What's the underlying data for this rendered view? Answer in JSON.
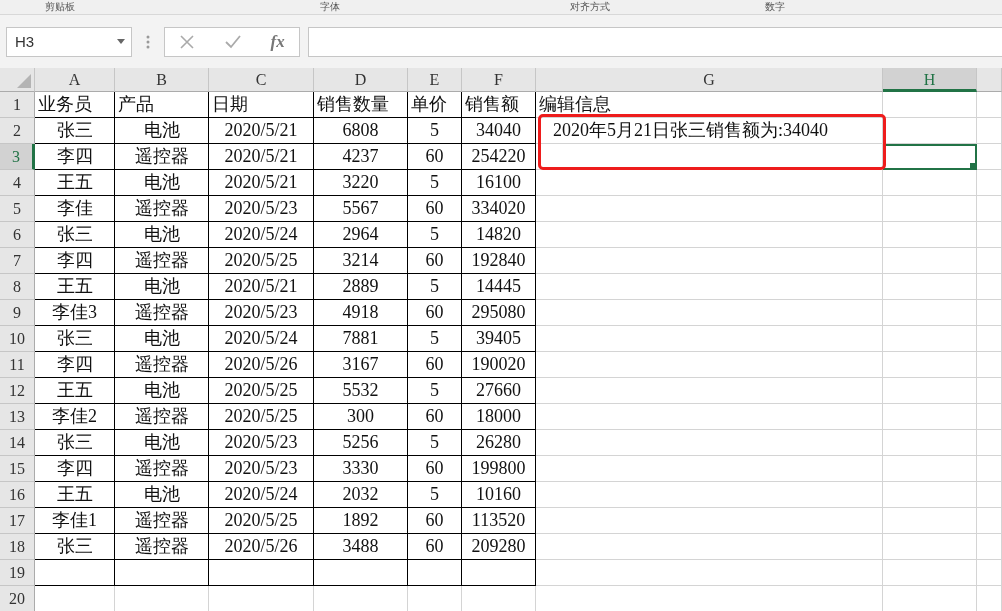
{
  "ribbon_groups": [
    "剪贴板",
    "字体",
    "对齐方式",
    "数字"
  ],
  "name_box": {
    "value": "H3"
  },
  "formula_bar": {
    "function_label": "fx"
  },
  "columns": [
    {
      "label": "A",
      "selected": false
    },
    {
      "label": "B",
      "selected": false
    },
    {
      "label": "C",
      "selected": false
    },
    {
      "label": "D",
      "selected": false
    },
    {
      "label": "E",
      "selected": false
    },
    {
      "label": "F",
      "selected": false
    },
    {
      "label": "G",
      "selected": false
    },
    {
      "label": "H",
      "selected": true
    }
  ],
  "rows": [
    {
      "number": "1",
      "selected": false,
      "cells": [
        "业务员",
        "产品",
        "日期",
        "销售数量",
        "单价",
        "销售额"
      ],
      "g": "编辑信息"
    },
    {
      "number": "2",
      "selected": false,
      "cells": [
        "张三",
        "电池",
        "2020/5/21",
        "6808",
        "5",
        "34040"
      ],
      "g": "2020年5月21日张三销售额为:34040"
    },
    {
      "number": "3",
      "selected": true,
      "cells": [
        "李四",
        "遥控器",
        "2020/5/21",
        "4237",
        "60",
        "254220"
      ]
    },
    {
      "number": "4",
      "selected": false,
      "cells": [
        "王五",
        "电池",
        "2020/5/21",
        "3220",
        "5",
        "16100"
      ]
    },
    {
      "number": "5",
      "selected": false,
      "cells": [
        "李佳",
        "遥控器",
        "2020/5/23",
        "5567",
        "60",
        "334020"
      ]
    },
    {
      "number": "6",
      "selected": false,
      "cells": [
        "张三",
        "电池",
        "2020/5/24",
        "2964",
        "5",
        "14820"
      ]
    },
    {
      "number": "7",
      "selected": false,
      "cells": [
        "李四",
        "遥控器",
        "2020/5/25",
        "3214",
        "60",
        "192840"
      ]
    },
    {
      "number": "8",
      "selected": false,
      "cells": [
        "王五",
        "电池",
        "2020/5/21",
        "2889",
        "5",
        "14445"
      ]
    },
    {
      "number": "9",
      "selected": false,
      "cells": [
        "李佳3",
        "遥控器",
        "2020/5/23",
        "4918",
        "60",
        "295080"
      ]
    },
    {
      "number": "10",
      "selected": false,
      "cells": [
        "张三",
        "电池",
        "2020/5/24",
        "7881",
        "5",
        "39405"
      ]
    },
    {
      "number": "11",
      "selected": false,
      "cells": [
        "李四",
        "遥控器",
        "2020/5/26",
        "3167",
        "60",
        "190020"
      ]
    },
    {
      "number": "12",
      "selected": false,
      "cells": [
        "王五",
        "电池",
        "2020/5/25",
        "5532",
        "5",
        "27660"
      ]
    },
    {
      "number": "13",
      "selected": false,
      "cells": [
        "李佳2",
        "遥控器",
        "2020/5/25",
        "300",
        "60",
        "18000"
      ]
    },
    {
      "number": "14",
      "selected": false,
      "cells": [
        "张三",
        "电池",
        "2020/5/23",
        "5256",
        "5",
        "26280"
      ]
    },
    {
      "number": "15",
      "selected": false,
      "cells": [
        "李四",
        "遥控器",
        "2020/5/23",
        "3330",
        "60",
        "199800"
      ]
    },
    {
      "number": "16",
      "selected": false,
      "cells": [
        "王五",
        "电池",
        "2020/5/24",
        "2032",
        "5",
        "10160"
      ]
    },
    {
      "number": "17",
      "selected": false,
      "cells": [
        "李佳1",
        "遥控器",
        "2020/5/25",
        "1892",
        "60",
        "113520"
      ]
    },
    {
      "number": "18",
      "selected": false,
      "cells": [
        "张三",
        "遥控器",
        "2020/5/26",
        "3488",
        "60",
        "209280"
      ]
    },
    {
      "number": "19",
      "selected": false
    },
    {
      "number": "20",
      "selected": false
    }
  ]
}
